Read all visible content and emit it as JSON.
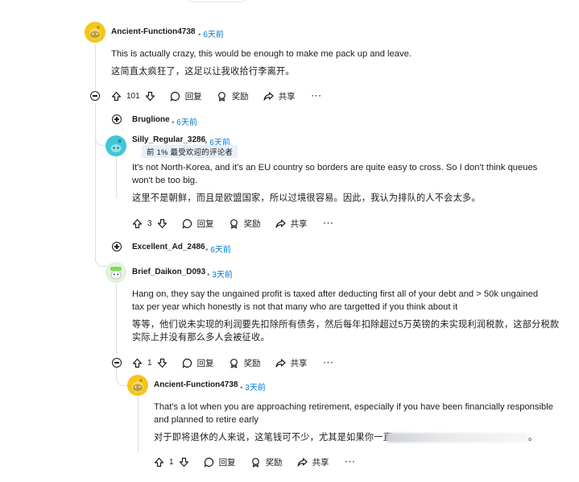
{
  "comments": [
    {
      "user": "Ancient-Function4738",
      "time": "6天前",
      "text_en": "This is actually crazy, this would be enough to make me pack up and leave.",
      "text_zh": "这简直太疯狂了，这足以让我收拾行李离开。",
      "votes": "101",
      "reply_label": "回复",
      "award_label": "奖励",
      "share_label": "共享",
      "more_label": "···",
      "avatar_color": "#f5c518"
    },
    {
      "user": "Bruglione",
      "time": "6天前",
      "collapsed": true
    },
    {
      "user": "Silly_Regular_3286",
      "time": "6天前",
      "badge": "前 1% 最受欢迎的评论者",
      "text_en_1": "It's not North-Korea, and it's an EU country so borders are quite easy to cross. So I don't think queues",
      "text_en_2": "won't be too big.",
      "text_zh": "这里不是朝鲜，而且是欧盟国家，所以过境很容易。因此，我认为排队的人不会太多。",
      "votes": "3",
      "reply_label": "回复",
      "award_label": "奖励",
      "share_label": "共享",
      "more_label": "···",
      "avatar_color": "#3ec7d6"
    },
    {
      "user": "Excellent_Ad_2486",
      "time": "6天前",
      "collapsed": true
    },
    {
      "user": "Brief_Daikon_D093",
      "time": "3天前",
      "text_en_1": "Hang on, they say the ungained profit is taxed after deducting first all of your debt and > 50k ungained",
      "text_en_2": "tax per year which honestly is not that many who are targetted if you think about it",
      "text_zh_1": "等等，他们说未实现的利润要先扣除所有债务，然后每年扣除超过5万英镑的未实现利润税款，这部分税款",
      "text_zh_2": "实际上并没有那么多人会被征收。",
      "votes": "1",
      "reply_label": "回复",
      "award_label": "奖励",
      "share_label": "共享",
      "more_label": "···",
      "avatar_color": "#7ed957"
    },
    {
      "user": "Ancient-Function4738",
      "time": "3天前",
      "text_en_1": "That's a lot when you are approaching retirement, especially if you have been financially responsible",
      "text_en_2": "and planned to retire early",
      "text_zh_visible": "对于即将退休的人来说，这笔钱可不少，尤其是如果你一直",
      "text_zh_end": "。",
      "votes": "1",
      "reply_label": "回复",
      "award_label": "奖励",
      "share_label": "共享",
      "more_label": "···",
      "avatar_color": "#f5c518"
    }
  ],
  "separator": "•"
}
